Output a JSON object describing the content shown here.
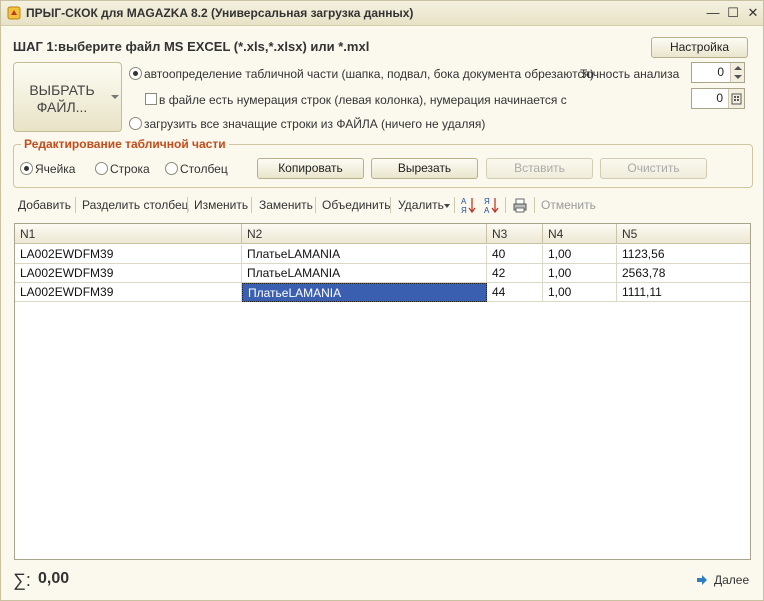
{
  "window": {
    "title": "ПРЫГ-СКОК для MAGAZKA 8.2 (Универсальная загрузка данных)",
    "minimize": "—",
    "maximize": "☐",
    "close": "✕"
  },
  "step": {
    "title": "ШАГ 1:выберите файл  MS EXCEL (*.xls,*.xlsx) или *.mxl",
    "settings_label": "Настройка",
    "choose_file_label": "ВЫБРАТЬ ФАЙЛ..."
  },
  "options": {
    "auto_detect_label": "автоопределение табличной части (шапка, подвал, бока документа обрезаются)",
    "numbering_label": "в файле есть нумерация строк (левая колонка), нумерация начинается с",
    "load_all_label": "загрузить все значащие строки из ФАЙЛА (ничего не удаляя)",
    "accuracy_label": "Точность анализа",
    "accuracy_value": "0",
    "numbering_start_value": "0"
  },
  "edit_group": {
    "title": "Редактирование табличной части",
    "mode_cell": "Ячейка",
    "mode_row": "Строка",
    "mode_column": "Столбец",
    "copy": "Копировать",
    "cut": "Вырезать",
    "paste": "Вставить",
    "clear": "Очистить"
  },
  "toolbar": {
    "add": "Добавить",
    "split_column": "Разделить столбец",
    "change": "Изменить",
    "replace": "Заменить",
    "merge": "Объединить",
    "delete": "Удалить",
    "cancel": "Отменить"
  },
  "table": {
    "columns": [
      "N1",
      "N2",
      "N3",
      "N4",
      "N5"
    ],
    "rows": [
      [
        "LA002EWDFM39",
        "ПлатьеLAMANIA",
        "40",
        "1,00",
        "1123,56"
      ],
      [
        "LA002EWDFM39",
        "ПлатьеLAMANIA",
        "42",
        "1,00",
        "2563,78"
      ],
      [
        "LA002EWDFM39",
        "ПлатьеLAMANIA",
        "44",
        "1,00",
        "1111,11"
      ]
    ]
  },
  "footer": {
    "sum_symbol": "∑:",
    "sum_value": "0,00",
    "next_label": "Далее"
  }
}
